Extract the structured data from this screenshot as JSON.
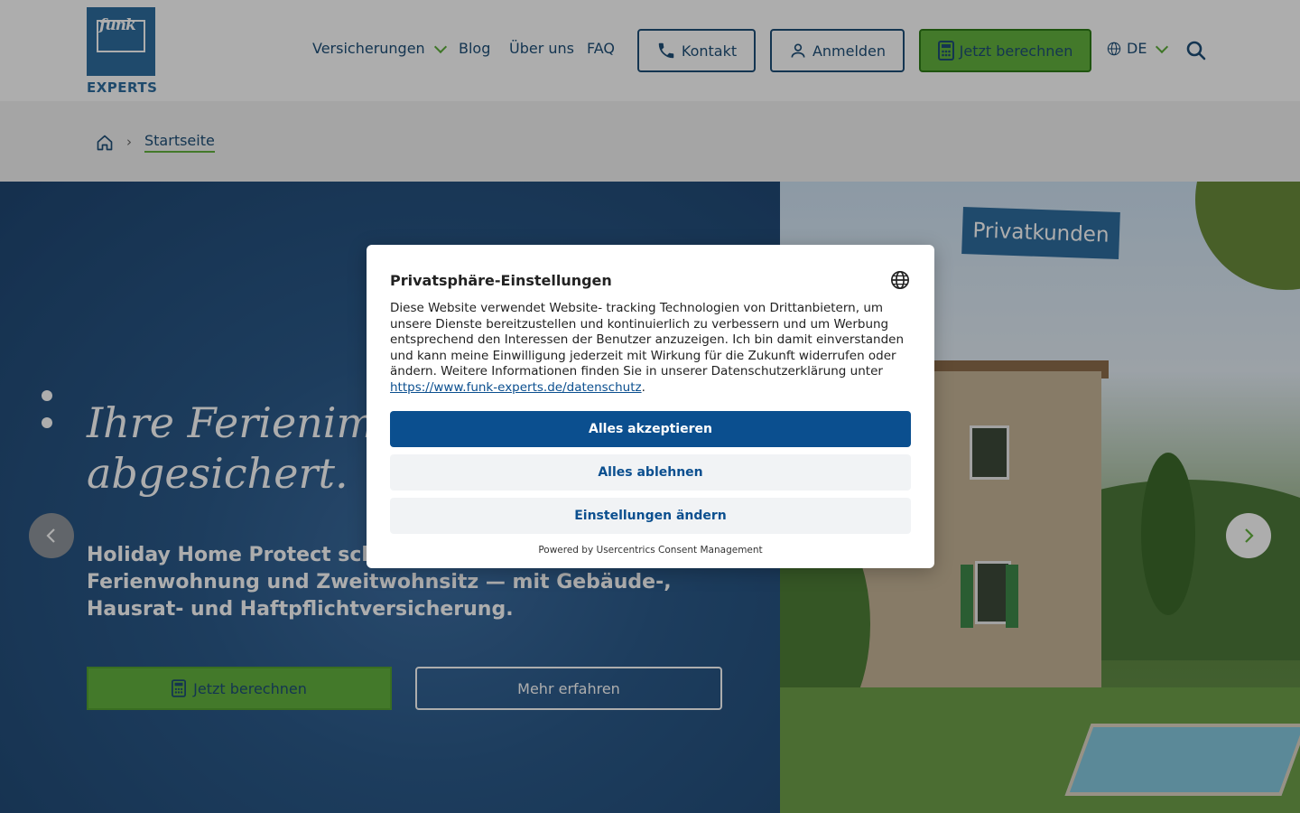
{
  "header": {
    "logo_word": "funk",
    "logo_text": "EXPERTS",
    "nav": [
      "Versicherungen",
      "Blog",
      "Über uns",
      "FAQ"
    ],
    "contact_label": "Kontakt",
    "login_label": "Anmelden",
    "calc_label": "Jetzt berechnen",
    "language": "DE"
  },
  "breadcrumb": {
    "current": "Startseite"
  },
  "hero": {
    "badge": "Privatkunden",
    "title_line1": "Ihre Ferienimmobilie",
    "title_line2": "abgesichert.",
    "subtitle": "Holiday Home Protect schützt Ferienhaus, Ferienwohnung und Zweitwohnsitz — mit Gebäude-, Hausrat- und Haftpflichtversicherung.",
    "primary_button": "Jetzt berechnen",
    "secondary_button": "Mehr erfahren"
  },
  "consent": {
    "title": "Privatsphäre-Einstellungen",
    "text": "Diese Website verwendet Website- tracking Technologien von Drittanbietern, um unsere Dienste bereitzustellen und kontinuierlich zu verbessern und um Werbung entsprechend den Interessen der Benutzer anzuzeigen. Ich bin damit einverstanden und kann meine Einwilligung jederzeit mit Wirkung für die Zukunft widerrufen oder ändern. Weitere Informationen finden Sie in unserer Datenschutzerklärung unter ",
    "link": "https://www.funk-experts.de/datenschutz",
    "text_end": ".",
    "accept": "Alles akzeptieren",
    "deny": "Alles ablehnen",
    "settings": "Einstellungen ändern",
    "powered": "Powered by Usercentrics Consent Management"
  },
  "colors": {
    "brand_blue": "#1e4f78",
    "brand_green": "#64b33e",
    "consent_blue": "#0b4f8f"
  }
}
